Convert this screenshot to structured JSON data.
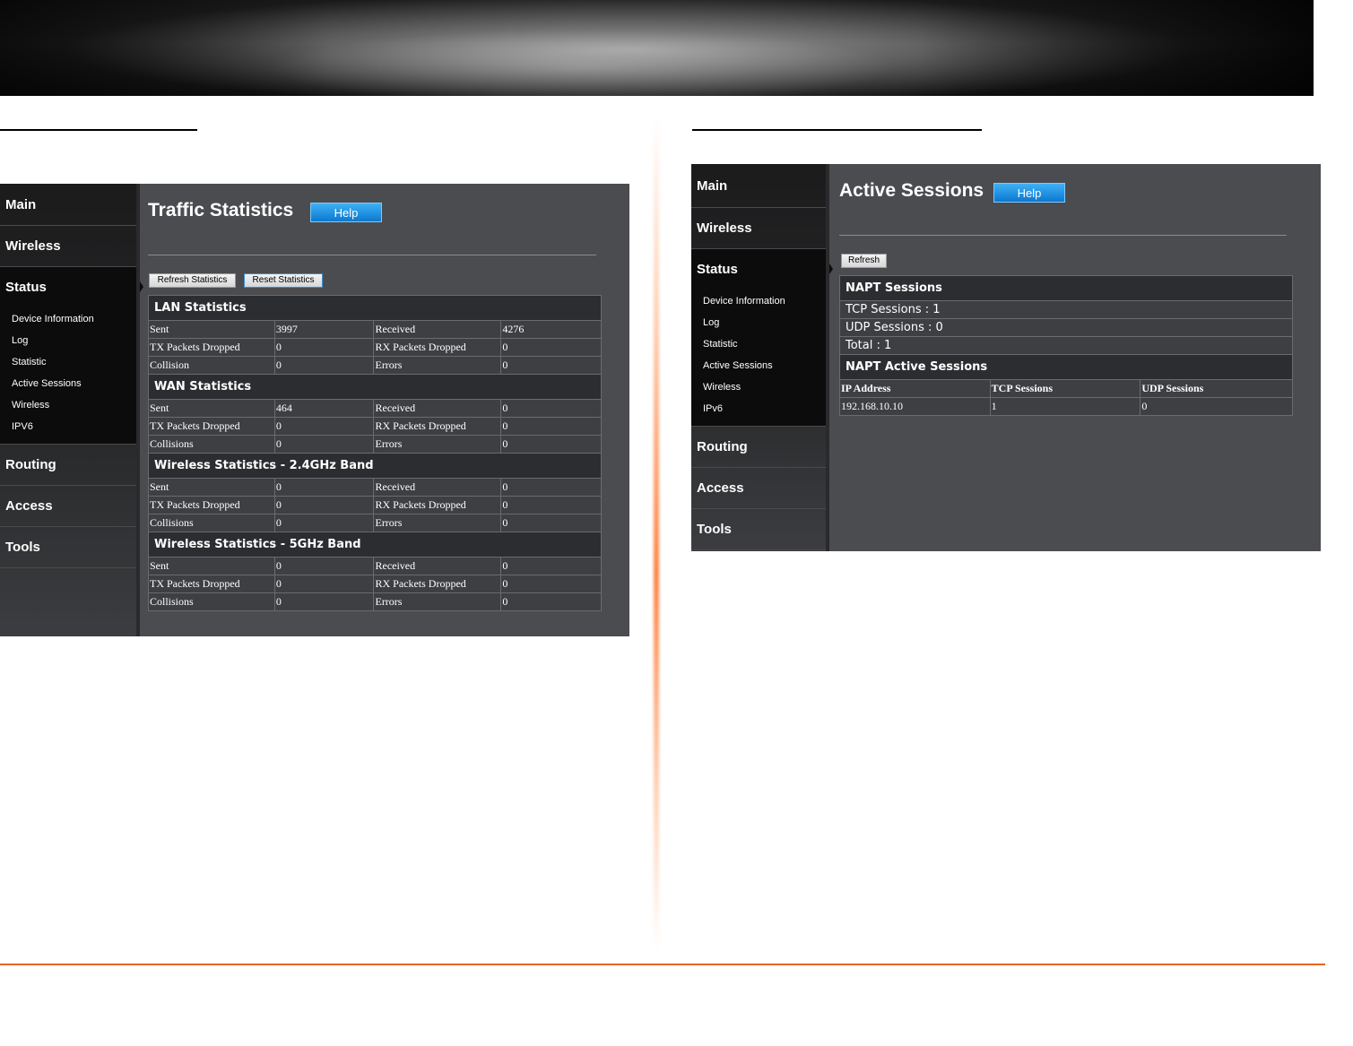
{
  "left_panel": {
    "sidebar": {
      "items_top": [
        "Main",
        "Wireless"
      ],
      "active": "Status",
      "sub_items": [
        "Device Information",
        "Log",
        "Statistic",
        "Active Sessions",
        "Wireless",
        "IPV6"
      ],
      "items_bottom": [
        "Routing",
        "Access",
        "Tools"
      ]
    },
    "title": "Traffic Statistics",
    "help_label": "Help",
    "refresh_label": "Refresh Statistics",
    "reset_label": "Reset Statistics",
    "sections": [
      {
        "title": "LAN Statistics",
        "rows": [
          [
            "Sent",
            "3997",
            "Received",
            "4276"
          ],
          [
            "TX Packets Dropped",
            "0",
            "RX Packets Dropped",
            "0"
          ],
          [
            "Collision",
            "0",
            "Errors",
            "0"
          ]
        ]
      },
      {
        "title": "WAN Statistics",
        "rows": [
          [
            "Sent",
            "464",
            "Received",
            "0"
          ],
          [
            "TX Packets Dropped",
            "0",
            "RX Packets Dropped",
            "0"
          ],
          [
            "Collisions",
            "0",
            "Errors",
            "0"
          ]
        ]
      },
      {
        "title": "Wireless Statistics - 2.4GHz Band",
        "rows": [
          [
            "Sent",
            "0",
            "Received",
            "0"
          ],
          [
            "TX Packets Dropped",
            "0",
            "RX Packets Dropped",
            "0"
          ],
          [
            "Collisions",
            "0",
            "Errors",
            "0"
          ]
        ]
      },
      {
        "title": "Wireless Statistics - 5GHz Band",
        "rows": [
          [
            "Sent",
            "0",
            "Received",
            "0"
          ],
          [
            "TX Packets Dropped",
            "0",
            "RX Packets Dropped",
            "0"
          ],
          [
            "Collisions",
            "0",
            "Errors",
            "0"
          ]
        ]
      }
    ]
  },
  "right_panel": {
    "sidebar": {
      "items_top": [
        "Main",
        "Wireless"
      ],
      "active": "Status",
      "sub_items": [
        "Device Information",
        "Log",
        "Statistic",
        "Active Sessions",
        "Wireless",
        "IPv6"
      ],
      "items_bottom": [
        "Routing",
        "Access",
        "Tools"
      ]
    },
    "title": "Active Sessions",
    "help_label": "Help",
    "refresh_label": "Refresh",
    "napt_title": "NAPT Sessions",
    "napt_rows": [
      "TCP Sessions : 1",
      "UDP Sessions : 0",
      "Total : 1"
    ],
    "active_title": "NAPT Active Sessions",
    "columns": [
      "IP Address",
      "TCP Sessions",
      "UDP Sessions"
    ],
    "rows": [
      [
        "192.168.10.10",
        "1",
        "0"
      ]
    ]
  },
  "colors": {
    "footer_rule": "#e8641b",
    "panel_bg": "#4b4c50",
    "help_button": "#1a8ee0"
  }
}
